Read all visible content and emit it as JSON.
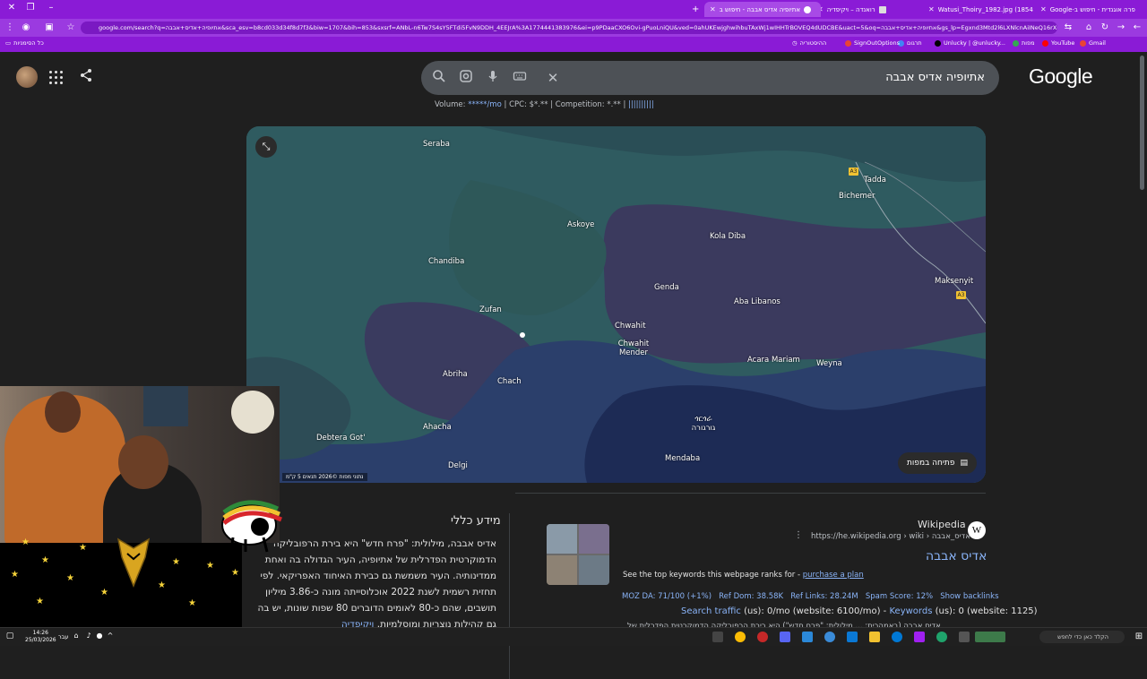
{
  "browser": {
    "tabs": [
      {
        "label": "Google-פרה אוגנדית - חיפוש ב",
        "active": false
      },
      {
        "label": "Watusi_Thoiry_1982.jpg (1854×",
        "active": false
      },
      {
        "label": "רואנדה – ויקיפדיה",
        "active": false
      },
      {
        "label": "אתיופיה אדיס אבבה - חיפוש ב",
        "active": true
      }
    ],
    "new_tab": "+",
    "url": "google.com/search?q=אתיופיה+אדיס+אבבה&sca_esv=b8cd033d34f8d7f3&biw=1707&bih=853&sxsrf=ANbL-n6Tw7S4sY5FTdi5FvN9DDH_4EEJrA%3A1774441383976&ei=p9PDaaCXO6Ovi-gPuoLniQU&ved=0ahUKEwjghwihbuTAxWj1wIHHTrBOVEQ4dUDCBE&uact=5&oq=אתיופיה+אדיס+אבבה&gs_lp=Egxnd3Mtd2l6LXNlcnAiINeQ16rXmdeV16TX",
    "bookmarks": [
      {
        "label": "כל הסימניות"
      },
      {
        "label": "Gmail"
      },
      {
        "label": "YouTube"
      },
      {
        "label": "מפות"
      },
      {
        "label": "Unlucky | @unlucky..."
      },
      {
        "label": "תרגום"
      },
      {
        "label": "SignOutOptions"
      },
      {
        "label": "ההיסטוריה"
      }
    ]
  },
  "google": {
    "logo": "Google",
    "query": "אתיופיה אדיס אבבה",
    "seo_bar": {
      "volume_label": "Volume:",
      "volume_value": "*****/mo",
      "rest": "| CPC: $*.** | Competition: *.** |",
      "bars": "||||||||||"
    }
  },
  "map": {
    "collapse_icon": "collapse-icon",
    "open_button": "פתיחה במפות",
    "attribution": "נתוני מפות ©2026   תנאים   5 ק\"מ",
    "places": [
      "Seraba",
      "Tadda",
      "Bichemer",
      "Askoye",
      "Kola Diba",
      "Chandiba",
      "Genda",
      "Aba Libanos",
      "Maksenyit",
      "Zufan",
      "Chwahit",
      "Chwahit Mender",
      "Acara Mariam",
      "Weyna",
      "Abriha",
      "Chach",
      "Ahacha",
      "ጎርጎራ גורגורה",
      "Debtera Got'",
      "Delgi",
      "Mendaba"
    ],
    "road_label": "A3"
  },
  "result": {
    "site_name": "Wikipedia",
    "url": "https://he.wikipedia.org › wiki › אדיס_אבבה",
    "title": "אדיס אבבה",
    "keywords_text": "See the top keywords this webpage ranks for -",
    "keywords_link": "purchase a plan",
    "moz_da": "MOZ DA: 71/100 (+1%)",
    "ref_dom": "Ref Dom: 38.58K",
    "ref_links": "Ref Links: 28.24M",
    "spam": "Spam Score: 12%",
    "backlinks": "Show backlinks",
    "traffic_label": "Search traffic",
    "traffic_value": "(us): 0/mo (website: 6100/mo) -",
    "keywords_label": "Keywords",
    "keywords_value": "(us): 0 (website: 1125)",
    "snippet_cut": "אדיס אבבה (באמהרית: ... מילולית: \"פרח חדש\") היא בירת הרפובליקה הדמוקרטית הפדרלית של"
  },
  "knowledge_panel": {
    "title": "מידע כללי",
    "body": "אדיס אבבה, מילולית: \"פרח חדש\" היא בירת הרפובליקה הדמוקרטית הפדרלית של אתיופיה, העיר הגדולה בה ואחת ממדינותיה. העיר משמשת גם כבירת האיחוד האפריקאי. לפי תחזית רשמית לשנת 2022 אוכלוסייתה מונה כ-3.86 מיליון תושבים, שהם כ-80 לאומים הדוברים 80 שפות שונות, יש בה גם קהילות נוצריות ומוסלמיות.",
    "link": "ויקיפדיה"
  },
  "taskbar": {
    "time": "14:26",
    "date": "25/03/2026",
    "lang": "עבר",
    "search_placeholder": "הקלד כאן כדי לחפש"
  }
}
